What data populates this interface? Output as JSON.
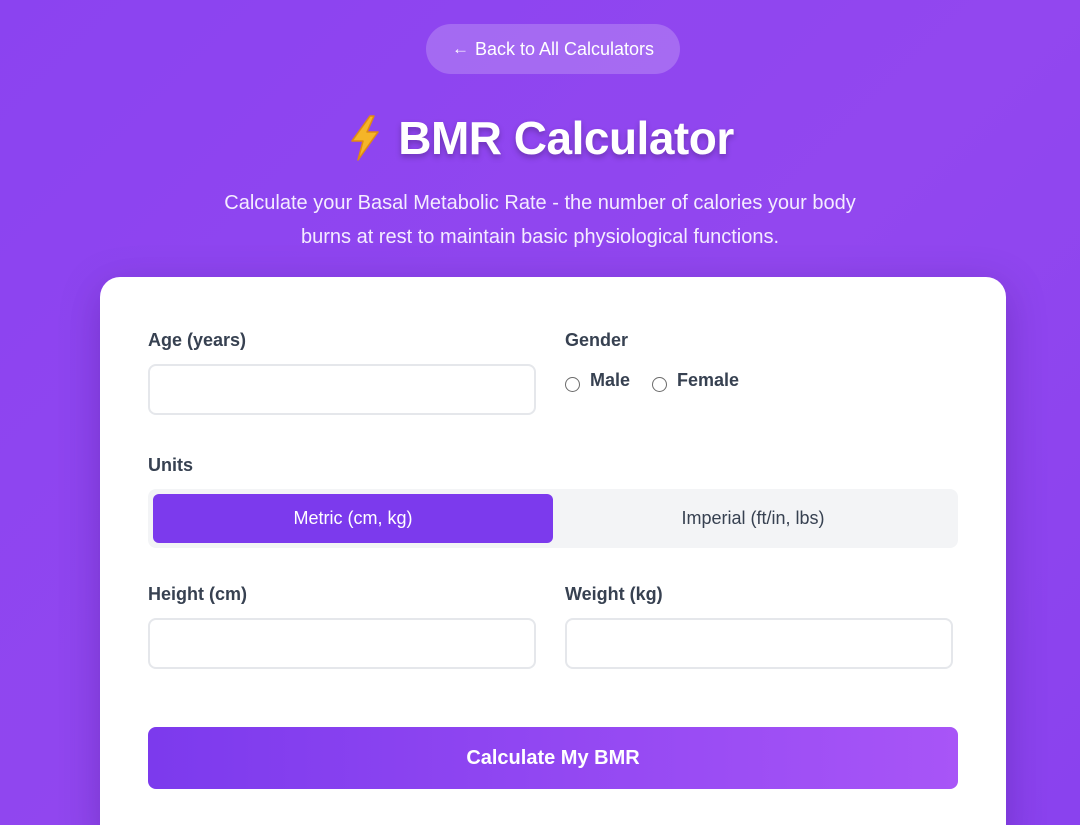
{
  "nav": {
    "back_arrow": "←",
    "back_label": "Back to All Calculators"
  },
  "header": {
    "icon": "lightning-bolt-icon",
    "title": "BMR Calculator",
    "subtitle": "Calculate your Basal Metabolic Rate - the number of calories your body burns at rest to maintain basic physiological functions."
  },
  "form": {
    "age_label": "Age (years)",
    "age_value": "",
    "gender_label": "Gender",
    "gender_options": [
      "Male",
      "Female"
    ],
    "units_label": "Units",
    "units_options": [
      "Metric (cm, kg)",
      "Imperial (ft/in, lbs)"
    ],
    "units_selected": "Metric (cm, kg)",
    "height_label": "Height (cm)",
    "height_value": "",
    "weight_label": "Weight (kg)",
    "weight_value": "",
    "submit_label": "Calculate My BMR"
  },
  "colors": {
    "background": "#8b43f0",
    "accent": "#7c3aed",
    "accent_end": "#a855f7",
    "bolt": "#f5b528"
  }
}
